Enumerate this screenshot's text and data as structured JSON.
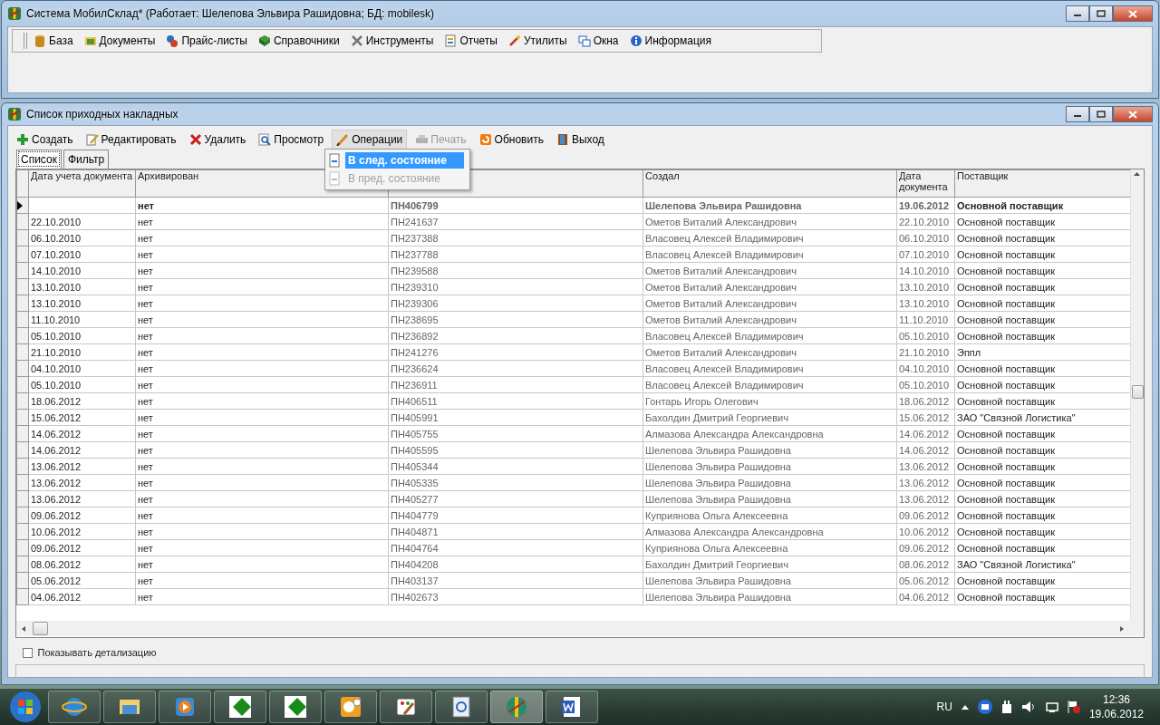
{
  "window": {
    "title": "Система МобилСклад* (Работает: Шелепова Эльвира Рашидовна; БД: mobilesk)"
  },
  "menu": [
    "База",
    "Документы",
    "Прайс-листы",
    "Справочники",
    "Инструменты",
    "Отчеты",
    "Утилиты",
    "Окна",
    "Информация"
  ],
  "child_window": {
    "title": "Список приходных накладных"
  },
  "toolbar": [
    {
      "label": "Создать",
      "disabled": false,
      "selected": false
    },
    {
      "label": "Редактировать",
      "disabled": false,
      "selected": false
    },
    {
      "label": "Удалить",
      "disabled": false,
      "selected": false
    },
    {
      "label": "Просмотр",
      "disabled": false,
      "selected": false
    },
    {
      "label": "Операции",
      "disabled": false,
      "selected": true
    },
    {
      "label": "Печать",
      "disabled": true,
      "selected": false
    },
    {
      "label": "Обновить",
      "disabled": false,
      "selected": false
    },
    {
      "label": "Выход",
      "disabled": false,
      "selected": false
    }
  ],
  "dropdown": [
    {
      "label": "В след. состояние",
      "selected": true,
      "disabled": false
    },
    {
      "label": "В пред. состояние",
      "selected": false,
      "disabled": true
    }
  ],
  "tabs": [
    {
      "label": "Список",
      "selected": true
    },
    {
      "label": "Фильтр",
      "selected": false
    }
  ],
  "table": {
    "columns": [
      "Дата учета документа",
      "Архивирован",
      null,
      "Создал",
      "Дата документа",
      "Поставщик"
    ],
    "rows": [
      {
        "current": true,
        "cells": [
          "",
          "нет",
          "ПН406799",
          "Шелепова Эльвира Рашидовна",
          "19.06.2012",
          "Основной поставщик"
        ]
      },
      {
        "current": false,
        "cells": [
          "22.10.2010",
          "нет",
          "ПН241637",
          "Ометов Виталий Александрович",
          "22.10.2010",
          "Основной поставщик"
        ]
      },
      {
        "current": false,
        "cells": [
          "06.10.2010",
          "нет",
          "ПН237388",
          "Власовец Алексей Владимирович",
          "06.10.2010",
          "Основной поставщик"
        ]
      },
      {
        "current": false,
        "cells": [
          "07.10.2010",
          "нет",
          "ПН237788",
          "Власовец Алексей Владимирович",
          "07.10.2010",
          "Основной поставщик"
        ]
      },
      {
        "current": false,
        "cells": [
          "14.10.2010",
          "нет",
          "ПН239588",
          "Ометов Виталий Александрович",
          "14.10.2010",
          "Основной поставщик"
        ]
      },
      {
        "current": false,
        "cells": [
          "13.10.2010",
          "нет",
          "ПН239310",
          "Ометов Виталий Александрович",
          "13.10.2010",
          "Основной поставщик"
        ]
      },
      {
        "current": false,
        "cells": [
          "13.10.2010",
          "нет",
          "ПН239306",
          "Ометов Виталий Александрович",
          "13.10.2010",
          "Основной поставщик"
        ]
      },
      {
        "current": false,
        "cells": [
          "11.10.2010",
          "нет",
          "ПН238695",
          "Ометов Виталий Александрович",
          "11.10.2010",
          "Основной поставщик"
        ]
      },
      {
        "current": false,
        "cells": [
          "05.10.2010",
          "нет",
          "ПН236892",
          "Власовец Алексей Владимирович",
          "05.10.2010",
          "Основной поставщик"
        ]
      },
      {
        "current": false,
        "cells": [
          "21.10.2010",
          "нет",
          "ПН241276",
          "Ометов Виталий Александрович",
          "21.10.2010",
          "Эппл"
        ]
      },
      {
        "current": false,
        "cells": [
          "04.10.2010",
          "нет",
          "ПН236624",
          "Власовец Алексей Владимирович",
          "04.10.2010",
          "Основной поставщик"
        ]
      },
      {
        "current": false,
        "cells": [
          "05.10.2010",
          "нет",
          "ПН236911",
          "Власовец Алексей Владимирович",
          "05.10.2010",
          "Основной поставщик"
        ]
      },
      {
        "current": false,
        "cells": [
          "18.06.2012",
          "нет",
          "ПН406511",
          "Гонтарь Игорь Олегович",
          "18.06.2012",
          "Основной поставщик"
        ]
      },
      {
        "current": false,
        "cells": [
          "15.06.2012",
          "нет",
          "ПН405991",
          "Бахолдин Дмитрий Георгиевич",
          "15.06.2012",
          "ЗАО \"Связной Логистика\""
        ]
      },
      {
        "current": false,
        "cells": [
          "14.06.2012",
          "нет",
          "ПН405755",
          "Алмазова Александра Александровна",
          "14.06.2012",
          "Основной поставщик"
        ]
      },
      {
        "current": false,
        "cells": [
          "14.06.2012",
          "нет",
          "ПН405595",
          "Шелепова Эльвира Рашидовна",
          "14.06.2012",
          "Основной поставщик"
        ]
      },
      {
        "current": false,
        "cells": [
          "13.06.2012",
          "нет",
          "ПН405344",
          "Шелепова Эльвира Рашидовна",
          "13.06.2012",
          "Основной поставщик"
        ]
      },
      {
        "current": false,
        "cells": [
          "13.06.2012",
          "нет",
          "ПН405335",
          "Шелепова Эльвира Рашидовна",
          "13.06.2012",
          "Основной поставщик"
        ]
      },
      {
        "current": false,
        "cells": [
          "13.06.2012",
          "нет",
          "ПН405277",
          "Шелепова Эльвира Рашидовна",
          "13.06.2012",
          "Основной поставщик"
        ]
      },
      {
        "current": false,
        "cells": [
          "09.06.2012",
          "нет",
          "ПН404779",
          "Куприянова Ольга Алексеевна",
          "09.06.2012",
          "Основной поставщик"
        ]
      },
      {
        "current": false,
        "cells": [
          "10.06.2012",
          "нет",
          "ПН404871",
          "Алмазова Александра Александровна",
          "10.06.2012",
          "Основной поставщик"
        ]
      },
      {
        "current": false,
        "cells": [
          "09.06.2012",
          "нет",
          "ПН404764",
          "Куприянова Ольга Алексеевна",
          "09.06.2012",
          "Основной поставщик"
        ]
      },
      {
        "current": false,
        "cells": [
          "08.06.2012",
          "нет",
          "ПН404208",
          "Бахолдин Дмитрий Георгиевич",
          "08.06.2012",
          "ЗАО \"Связной Логистика\""
        ]
      },
      {
        "current": false,
        "cells": [
          "05.06.2012",
          "нет",
          "ПН403137",
          "Шелепова Эльвира Рашидовна",
          "05.06.2012",
          "Основной поставщик"
        ]
      },
      {
        "current": false,
        "cells": [
          "04.06.2012",
          "нет",
          "ПН402673",
          "Шелепова Эльвира Рашидовна",
          "04.06.2012",
          "Основной поставщик"
        ]
      }
    ]
  },
  "show_details": {
    "label": "Показывать детализацию",
    "checked": false
  },
  "taskbar": {
    "apps": [
      {
        "selected": false
      },
      {
        "selected": false
      },
      {
        "selected": false
      },
      {
        "selected": false
      },
      {
        "selected": false
      },
      {
        "selected": false
      },
      {
        "selected": false
      },
      {
        "selected": false
      },
      {
        "selected": true
      },
      {
        "selected": false
      }
    ],
    "language": "RU",
    "time": "12:36",
    "date": "19.06.2012"
  }
}
